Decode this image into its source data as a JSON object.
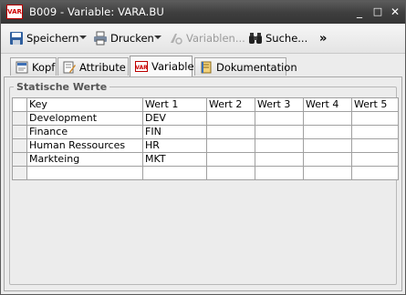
{
  "window": {
    "app_icon_text": "VAR",
    "title": "B009 - Variable: VARA.BU",
    "controls": {
      "minimize": "_",
      "maximize": "□",
      "close": "✕"
    }
  },
  "toolbar": {
    "save_label": "Speichern",
    "print_label": "Drucken",
    "variables_label": "Variablen...",
    "search_label": "Suche...",
    "more_label": "»"
  },
  "tabs": [
    {
      "label": "Kopf"
    },
    {
      "label": "Attribute"
    },
    {
      "label": "Variable",
      "active": true
    },
    {
      "label": "Dokumentation"
    }
  ],
  "section": {
    "title": "Statische Werte"
  },
  "table": {
    "columns": [
      "Key",
      "Wert 1",
      "Wert 2",
      "Wert 3",
      "Wert 4",
      "Wert 5"
    ],
    "rows": [
      [
        "Development",
        "DEV",
        "",
        "",
        "",
        ""
      ],
      [
        "Finance",
        "FIN",
        "",
        "",
        "",
        ""
      ],
      [
        "Human Ressources",
        "HR",
        "",
        "",
        "",
        ""
      ],
      [
        "Markteing",
        "MKT",
        "",
        "",
        "",
        ""
      ],
      [
        "",
        "",
        "",
        "",
        "",
        ""
      ]
    ]
  }
}
